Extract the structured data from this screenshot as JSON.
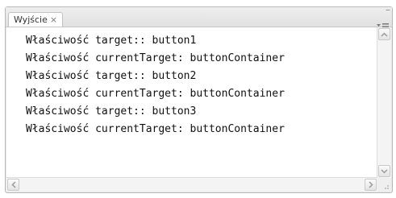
{
  "tab": {
    "label": "Wyjście",
    "close_glyph": "×"
  },
  "panel_controls": {
    "minimize_glyph": "–",
    "close_glyph": "×",
    "menu_icon": "panel-menu-icon"
  },
  "output": {
    "lines": [
      "Właściwość target:: button1",
      "Właściwość currentTarget: buttonContainer",
      "Właściwość target:: button2",
      "Właściwość currentTarget: buttonContainer",
      "Właściwość target:: button3",
      "Właściwość currentTarget: buttonContainer"
    ]
  },
  "colors": {
    "panel_background": "#e9e9e9",
    "content_background": "#ffffff",
    "text": "#111111"
  }
}
